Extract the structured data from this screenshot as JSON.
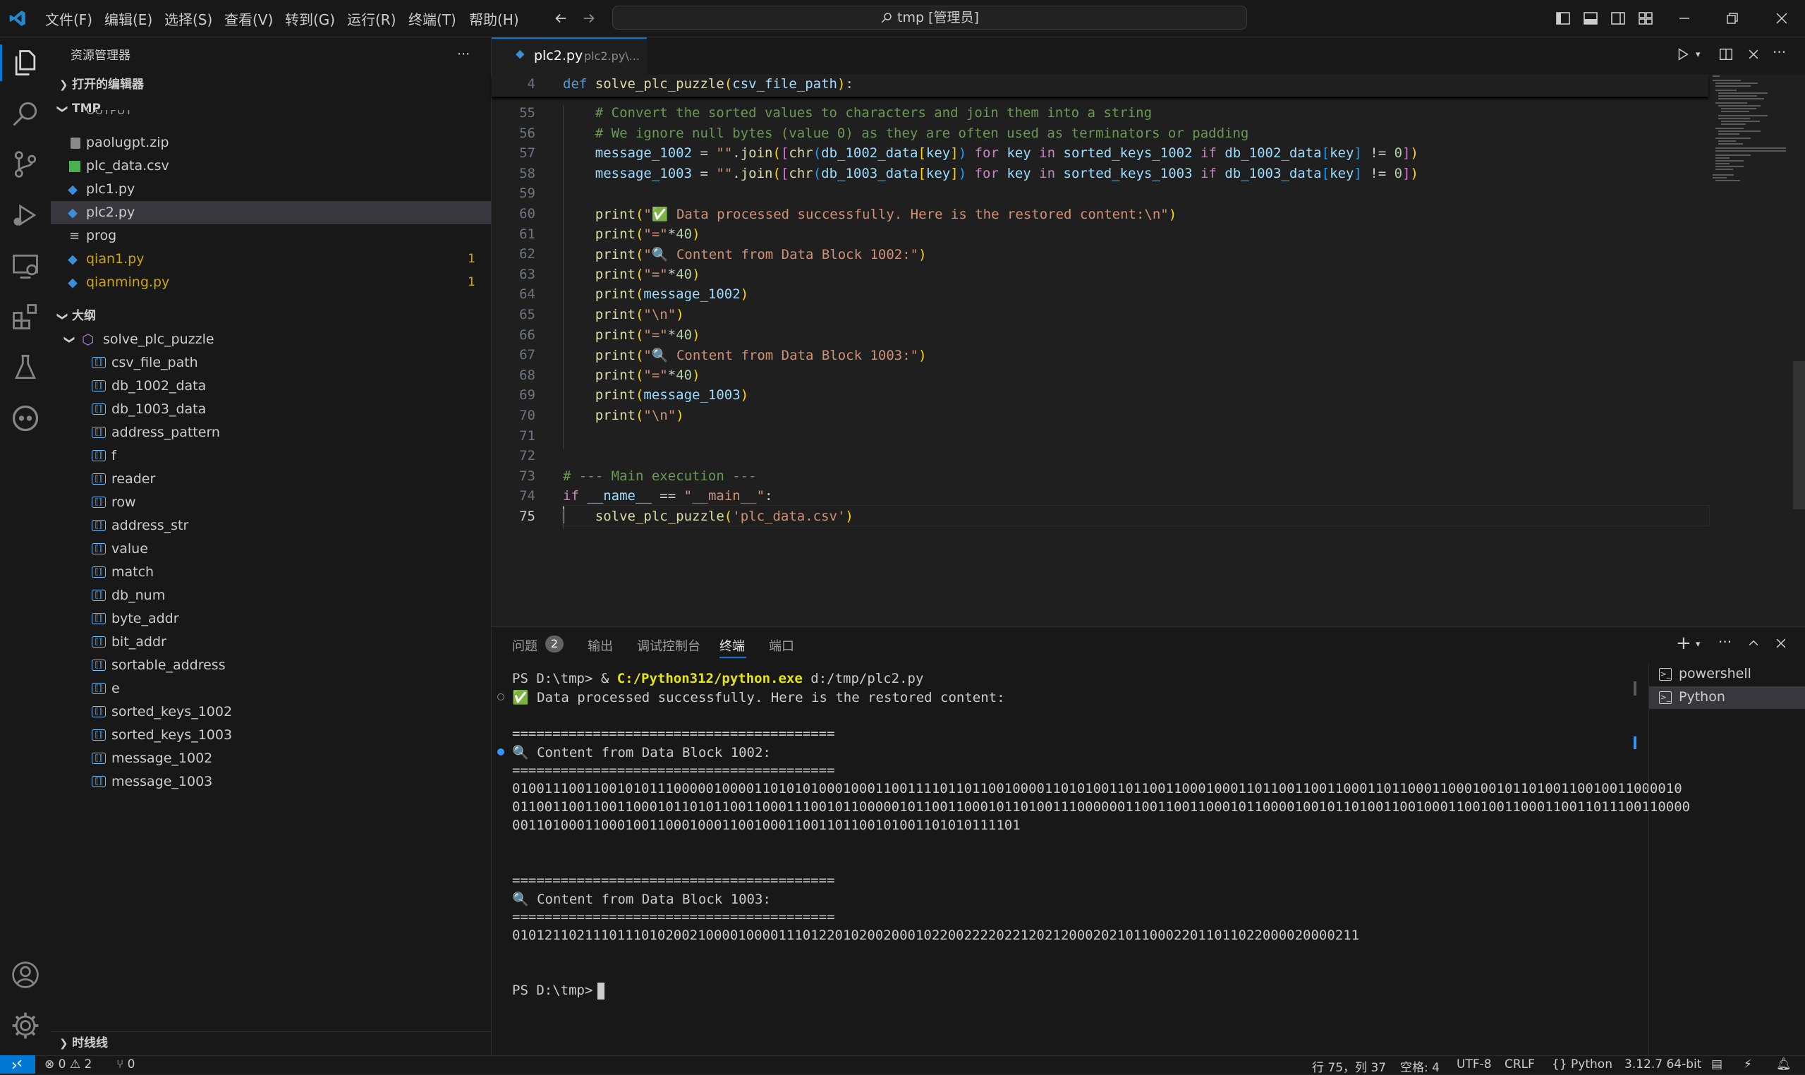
{
  "menu": [
    "文件(F)",
    "编辑(E)",
    "选择(S)",
    "查看(V)",
    "转到(G)",
    "运行(R)",
    "终端(T)",
    "帮助(H)"
  ],
  "search": {
    "text": "tmp [管理员]"
  },
  "sidebar": {
    "title": "资源管理器",
    "more": "···",
    "open_editors": "打开的编辑器",
    "folder": "TMP",
    "cut_top": "OUTPUT",
    "files": [
      {
        "name": "paolugpt.zip",
        "type": "zip",
        "badge": ""
      },
      {
        "name": "plc_data.csv",
        "type": "csv",
        "badge": ""
      },
      {
        "name": "plc1.py",
        "type": "py",
        "badge": ""
      },
      {
        "name": "plc2.py",
        "type": "py",
        "badge": ""
      },
      {
        "name": "prog",
        "type": "txt",
        "badge": ""
      },
      {
        "name": "qian1.py",
        "type": "py",
        "badge": "1"
      },
      {
        "name": "qianming.py",
        "type": "py",
        "badge": "1"
      }
    ],
    "outline": "大纲",
    "outline_root": "solve_plc_puzzle",
    "outline_items": [
      "csv_file_path",
      "db_1002_data",
      "db_1003_data",
      "address_pattern",
      "f",
      "reader",
      "row",
      "address_str",
      "value",
      "match",
      "db_num",
      "byte_addr",
      "bit_addr",
      "sortable_address",
      "e",
      "sorted_keys_1002",
      "sorted_keys_1003",
      "message_1002",
      "message_1003"
    ],
    "timeline": "时线线"
  },
  "editor": {
    "tab_name": "plc2.py",
    "tab_path": "plc2.py\\...",
    "sticky_line_no": "4",
    "sticky_code": "def solve_plc_puzzle(csv_file_path):",
    "line_numbers": [
      "55",
      "56",
      "57",
      "58",
      "59",
      "60",
      "61",
      "62",
      "63",
      "64",
      "65",
      "66",
      "67",
      "68",
      "69",
      "70",
      "71",
      "72",
      "73",
      "74",
      "75"
    ],
    "lines": [
      "    # Convert the sorted values to characters and join them into a string",
      "    # We ignore null bytes (value 0) as they are often used as terminators or padding",
      "    message_1002 = \"\".join([chr(db_1002_data[key]) for key in sorted_keys_1002 if db_1002_data[key] != 0])",
      "    message_1003 = \"\".join([chr(db_1003_data[key]) for key in sorted_keys_1003 if db_1003_data[key] != 0])",
      "",
      "    print(\"✅ Data processed successfully. Here is the restored content:\\n\")",
      "    print(\"=\"*40)",
      "    print(\"🔍 Content from Data Block 1002:\")",
      "    print(\"=\"*40)",
      "    print(message_1002)",
      "    print(\"\\n\")",
      "    print(\"=\"*40)",
      "    print(\"🔍 Content from Data Block 1003:\")",
      "    print(\"=\"*40)",
      "    print(message_1003)",
      "    print(\"\\n\")",
      "",
      "",
      "# --- Main execution ---",
      "if __name__ == \"__main__\":",
      "    solve_plc_puzzle('plc_data.csv')"
    ]
  },
  "panel": {
    "tabs": [
      "问题",
      "输出",
      "调试控制台",
      "终端",
      "端口"
    ],
    "problems_count": "2",
    "terminal_lines": [
      "PS D:\\tmp> & C:/Python312/python.exe d:/tmp/plc2.py",
      "✅ Data processed successfully. Here is the restored content:",
      "",
      "========================================",
      "🔍 Content from Data Block 1002:",
      "========================================",
      "0100111001100101011100000100001101010100010001100111101101100100001101010011011001100010001101100110011000110110001100010010110100110010011000010110011001100110011000101101011001100011100101100000101100110001011010011100000011001100110001011000010010110100110010001100100110001100110111001100000011010001100010011000100011001000110011011001010011010101111101",
      "",
      "",
      "========================================",
      "🔍 Content from Data Block 1003:",
      "========================================",
      "010121102111011101020021000010000111012201020020001022002222022120212000202101100022011011022000020000211",
      "",
      "",
      "PS D:\\tmp> "
    ],
    "terminal_wrapped": [
      "0100111001100101011100000100001101010100010001100111101101100100001101010011011001100010001101100110011000110110001100010010110100110010011000010",
      "01100110011001100010110101100110001110010110000010110011000101101001110000001100110011000101100001001011010011001000110010011000110011011100110000",
      "001101000110001001100010001100100011001101100101001101010111101"
    ],
    "shells": [
      "powershell",
      "Python"
    ]
  },
  "status": {
    "errors": "0",
    "warnings": "2",
    "ports": "0",
    "position": "行 75，列 37",
    "spaces": "空格: 4",
    "encoding": "UTF-8",
    "eol": "CRLF",
    "language": "Python",
    "interpreter": "3.12.7 64-bit"
  },
  "colors": {
    "accent": "#0078d4",
    "bg": "#1f1f1f",
    "sidebar": "#181818",
    "warning": "#cca700"
  }
}
